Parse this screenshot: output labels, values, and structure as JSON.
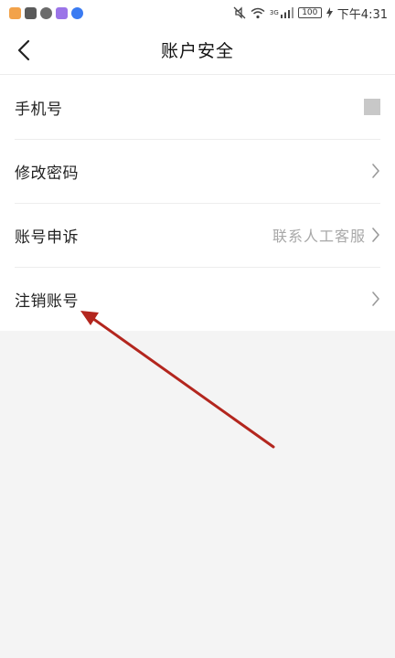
{
  "status_bar": {
    "battery": "100",
    "time": "下午4:31",
    "network_badge": "3G"
  },
  "nav": {
    "title": "账户安全"
  },
  "rows": [
    {
      "label": "手机号",
      "value": "",
      "has_chevron": false
    },
    {
      "label": "修改密码",
      "value": "",
      "has_chevron": true
    },
    {
      "label": "账号申诉",
      "value": "联系人工客服",
      "has_chevron": true
    },
    {
      "label": "注销账号",
      "value": "",
      "has_chevron": true
    }
  ],
  "colors": {
    "annotation_arrow": "#b3261e",
    "secondary_text": "#a8a8a8",
    "page_background": "#f4f4f4"
  },
  "icons": {
    "back": "chevron-left-icon",
    "row_arrow": "chevron-right-icon"
  }
}
